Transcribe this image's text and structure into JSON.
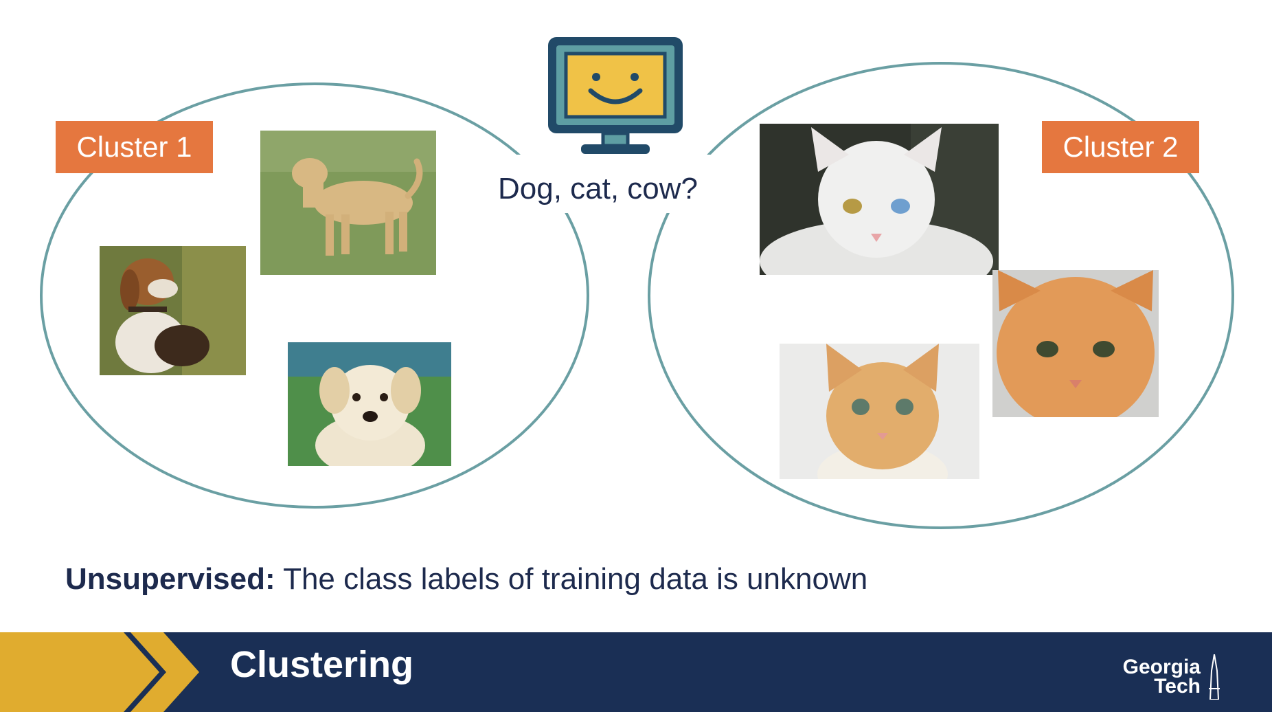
{
  "clusters": [
    {
      "label": "Cluster 1"
    },
    {
      "label": "Cluster 2"
    }
  ],
  "question": "Dog, cat, cow?",
  "caption": {
    "bold": "Unsupervised:",
    "text": " The class labels of training data is unknown"
  },
  "footer": {
    "title": "Clustering",
    "logo_line1": "Georgia",
    "logo_line2": "Tech"
  },
  "icons": [
    "computer-monitor-smiley-icon",
    "chevron-icon"
  ],
  "colors": {
    "cluster_outline": "#6a9fa3",
    "label_bg": "#e5773f",
    "text_navy": "#1d2a4d",
    "footer_bg": "#1a2f55",
    "footer_gold": "#e0ac2f",
    "monitor_frame": "#214a68",
    "monitor_teal": "#5e9ea3",
    "monitor_screen": "#f0c247"
  }
}
